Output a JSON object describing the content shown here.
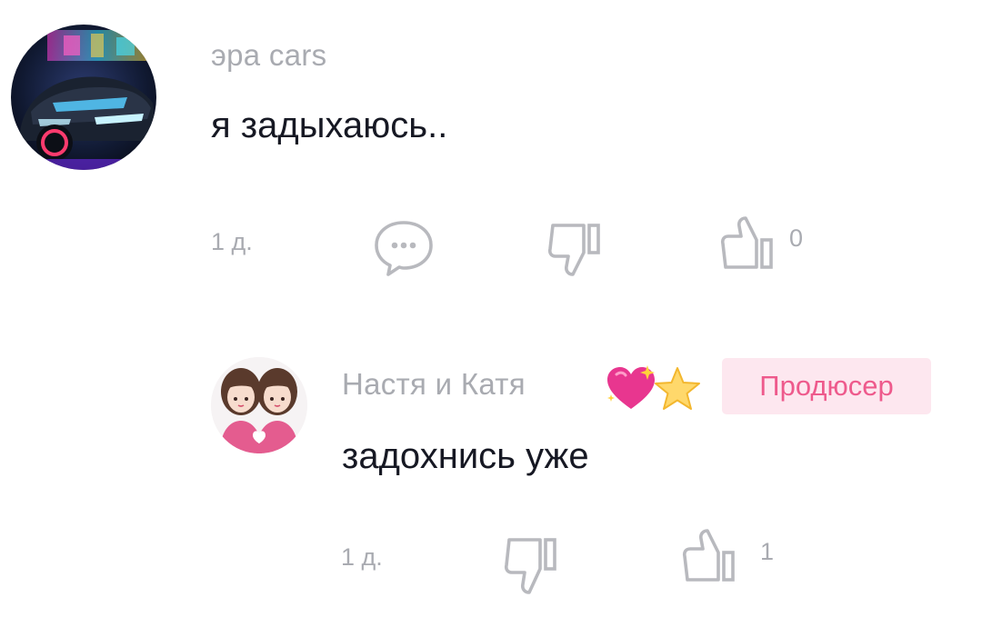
{
  "comments": [
    {
      "avatar": "car-avatar",
      "username": "эра cars",
      "text": "я задыхаюсь..",
      "time": "1 д.",
      "like_count": "0"
    }
  ],
  "replies": [
    {
      "avatar": "twins-avatar",
      "username": "Настя и Катя",
      "emojis": [
        "sparkling-heart",
        "star"
      ],
      "badge": "Продюсер",
      "text": "задохнись уже",
      "time": "1 д.",
      "like_count": "1"
    }
  ],
  "icons": {
    "reply": "reply-bubble-icon",
    "dislike": "thumbs-down-icon",
    "like": "thumbs-up-icon"
  },
  "colors": {
    "text_primary": "#161823",
    "text_secondary": "#a9abb1",
    "badge_bg": "#fde7ef",
    "badge_text": "#ee5a8c"
  }
}
